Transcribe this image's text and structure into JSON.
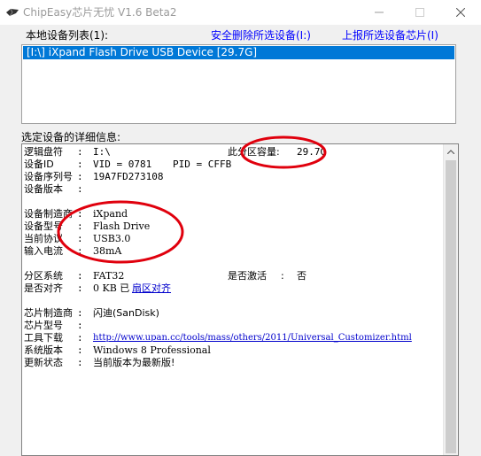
{
  "window": {
    "title": "ChipEasy芯片无忧 V1.6 Beta2"
  },
  "header": {
    "device_list_label": "本地设备列表(1):",
    "safe_remove_link": "安全删除所选设备(I:)",
    "report_chip_link": "上报所选设备芯片(I)"
  },
  "device_list": {
    "items": [
      {
        "label": "[I:\\] iXpand Flash Drive USB Device [29.7G]"
      }
    ]
  },
  "details": {
    "label": "选定设备的详细信息:",
    "drive_letter": {
      "key": "逻辑盘符",
      "value": "I:\\"
    },
    "capacity": {
      "key": "此分区容量:",
      "value": "29.7G"
    },
    "device_id": {
      "key": "设备ID",
      "vid": "VID = 0781",
      "pid": "PID = CFFB"
    },
    "serial": {
      "key": "设备序列号",
      "value": "19A7FD273108"
    },
    "version": {
      "key": "设备版本",
      "value": ""
    },
    "manufacturer": {
      "key": "设备制造商",
      "value": "iXpand"
    },
    "model": {
      "key": "设备型号",
      "value": "Flash Drive"
    },
    "protocol": {
      "key": "当前协议",
      "value": "USB3.0"
    },
    "current": {
      "key": "输入电流",
      "value": "38mA"
    },
    "filesystem": {
      "key": "分区系统",
      "value": "FAT32"
    },
    "activated": {
      "key": "是否激活",
      "value": "否"
    },
    "aligned": {
      "key": "是否对齐",
      "value": "0 KB 已",
      "link": "扇区对齐"
    },
    "chip_vendor": {
      "key": "芯片制造商",
      "value": "闪迪(SanDisk)"
    },
    "chip_model": {
      "key": "芯片型号",
      "value": ""
    },
    "tool_download": {
      "key": "工具下载",
      "value": "http://www.upan.cc/tools/mass/others/2011/Universal_Customizer.html"
    },
    "os_version": {
      "key": "系统版本",
      "value": "Windows 8 Professional"
    },
    "update_status": {
      "key": "更新状态",
      "value": "当前版本为最新版!"
    },
    "colon": ":"
  },
  "colors": {
    "selection": "#0078d7",
    "link": "#0000ff",
    "annotation": "#e0000d"
  }
}
